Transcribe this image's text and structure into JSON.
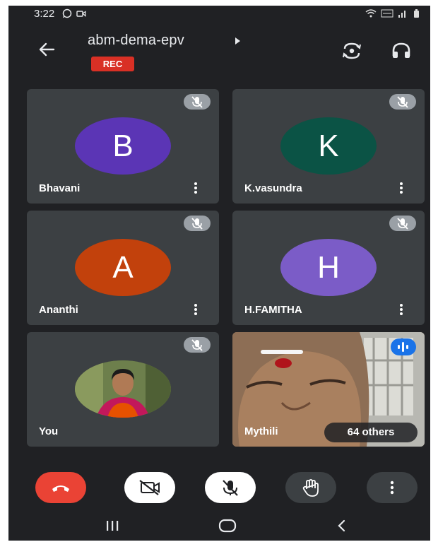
{
  "status_bar": {
    "time": "3:22",
    "icons": [
      "whatsapp-icon",
      "video-icon",
      "wifi-icon",
      "volte-icon",
      "signal-icon",
      "battery-icon"
    ]
  },
  "header": {
    "back_icon": "arrow-left-icon",
    "meeting_code": "abm-dema-epv",
    "rec_label": "REC",
    "switch_camera_icon": "switch-camera-icon",
    "audio_icon": "headphones-icon"
  },
  "participants": [
    {
      "name": "Bhavani",
      "initial": "B",
      "color": "#5b35b5",
      "muted": true
    },
    {
      "name": "K.vasundra",
      "initial": "K",
      "color": "#0b5345",
      "muted": true
    },
    {
      "name": "Ananthi",
      "initial": "A",
      "color": "#c2410c",
      "muted": true
    },
    {
      "name": "H.FAMITHA",
      "initial": "H",
      "color": "#7b5cc7",
      "muted": true
    },
    {
      "name": "You",
      "muted": true
    },
    {
      "name": "Mythili",
      "others": "64 others",
      "speaking": true
    }
  ],
  "controls": [
    {
      "name": "end-call",
      "icon": "end-call-icon",
      "color": "#ea4335"
    },
    {
      "name": "camera-off",
      "icon": "video-off-icon",
      "color": "#ffffff"
    },
    {
      "name": "mic-off",
      "icon": "mic-off-icon",
      "color": "#ffffff"
    },
    {
      "name": "raise-hand",
      "icon": "hand-icon",
      "color": "#3c4043"
    },
    {
      "name": "more",
      "icon": "more-vert-icon",
      "color": "#3c4043"
    }
  ],
  "nav": [
    "recent-apps-icon",
    "home-icon",
    "back-icon"
  ]
}
